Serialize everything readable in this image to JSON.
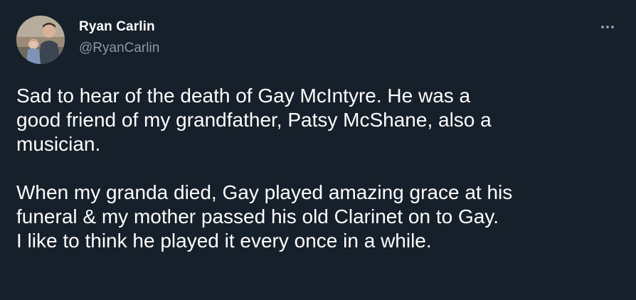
{
  "author": {
    "display_name": "Ryan Carlin",
    "handle": "@RyanCarlin"
  },
  "menu": {
    "icon": "more-horizontal-icon"
  },
  "tweet": {
    "paragraph1": [
      "Sad to hear of the death of Gay McIntyre. He was a",
      "good friend of my grandfather, Patsy McShane, also a",
      "musician."
    ],
    "paragraph2": [
      "When my granda died, Gay played amazing grace at his",
      "funeral & my mother passed his old Clarinet on to Gay.",
      "I like to think he played it every once in a while."
    ]
  },
  "colors": {
    "background": "#15202b",
    "text": "#ffffff",
    "secondary_text": "#8899a6"
  }
}
